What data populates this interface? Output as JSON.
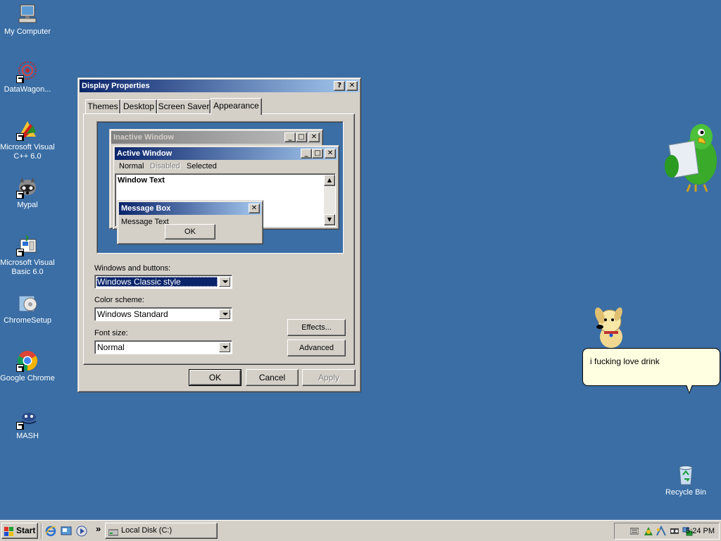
{
  "desktop": {
    "icons": [
      {
        "label": "My Computer"
      },
      {
        "label": "DataWagon..."
      },
      {
        "label": "Microsoft Visual C++ 6.0"
      },
      {
        "label": "Mypal"
      },
      {
        "label": "Microsoft Visual Basic 6.0"
      },
      {
        "label": "ChromeSetup"
      },
      {
        "label": "Google Chrome"
      },
      {
        "label": "MASH"
      },
      {
        "label": "Recycle Bin"
      }
    ]
  },
  "dialog": {
    "title": "Display Properties",
    "help_btn": "?",
    "close_btn": "✕",
    "tabs": [
      {
        "label": "Themes"
      },
      {
        "label": "Desktop"
      },
      {
        "label": "Screen Saver"
      },
      {
        "label": "Appearance"
      }
    ],
    "preview": {
      "inactive_title": "Inactive Window",
      "active_title": "Active Window",
      "menu_normal": "Normal",
      "menu_disabled": "Disabled",
      "menu_selected": "Selected",
      "window_text": "Window Text",
      "msgbox_title": "Message Box",
      "msgbox_text": "Message Text",
      "msgbox_ok": "OK"
    },
    "windows_buttons_label": "Windows and buttons:",
    "windows_buttons_value": "Windows Classic style",
    "color_scheme_label": "Color scheme:",
    "color_scheme_value": "Windows Standard",
    "font_size_label": "Font size:",
    "font_size_value": "Normal",
    "effects_btn": "Effects...",
    "advanced_btn": "Advanced",
    "ok_btn": "OK",
    "cancel_btn": "Cancel",
    "apply_btn": "Apply"
  },
  "agent": {
    "bubble_text": "i fucking love drink"
  },
  "taskbar": {
    "start_label": "Start",
    "chevron": "»",
    "task_label": "Local Disk (C:)",
    "clock": "5:24 PM"
  },
  "colors": {
    "desktop": "#3a6ea5",
    "title_active_start": "#0a246a",
    "title_active_end": "#a6caf0",
    "face": "#d4d0c8"
  }
}
